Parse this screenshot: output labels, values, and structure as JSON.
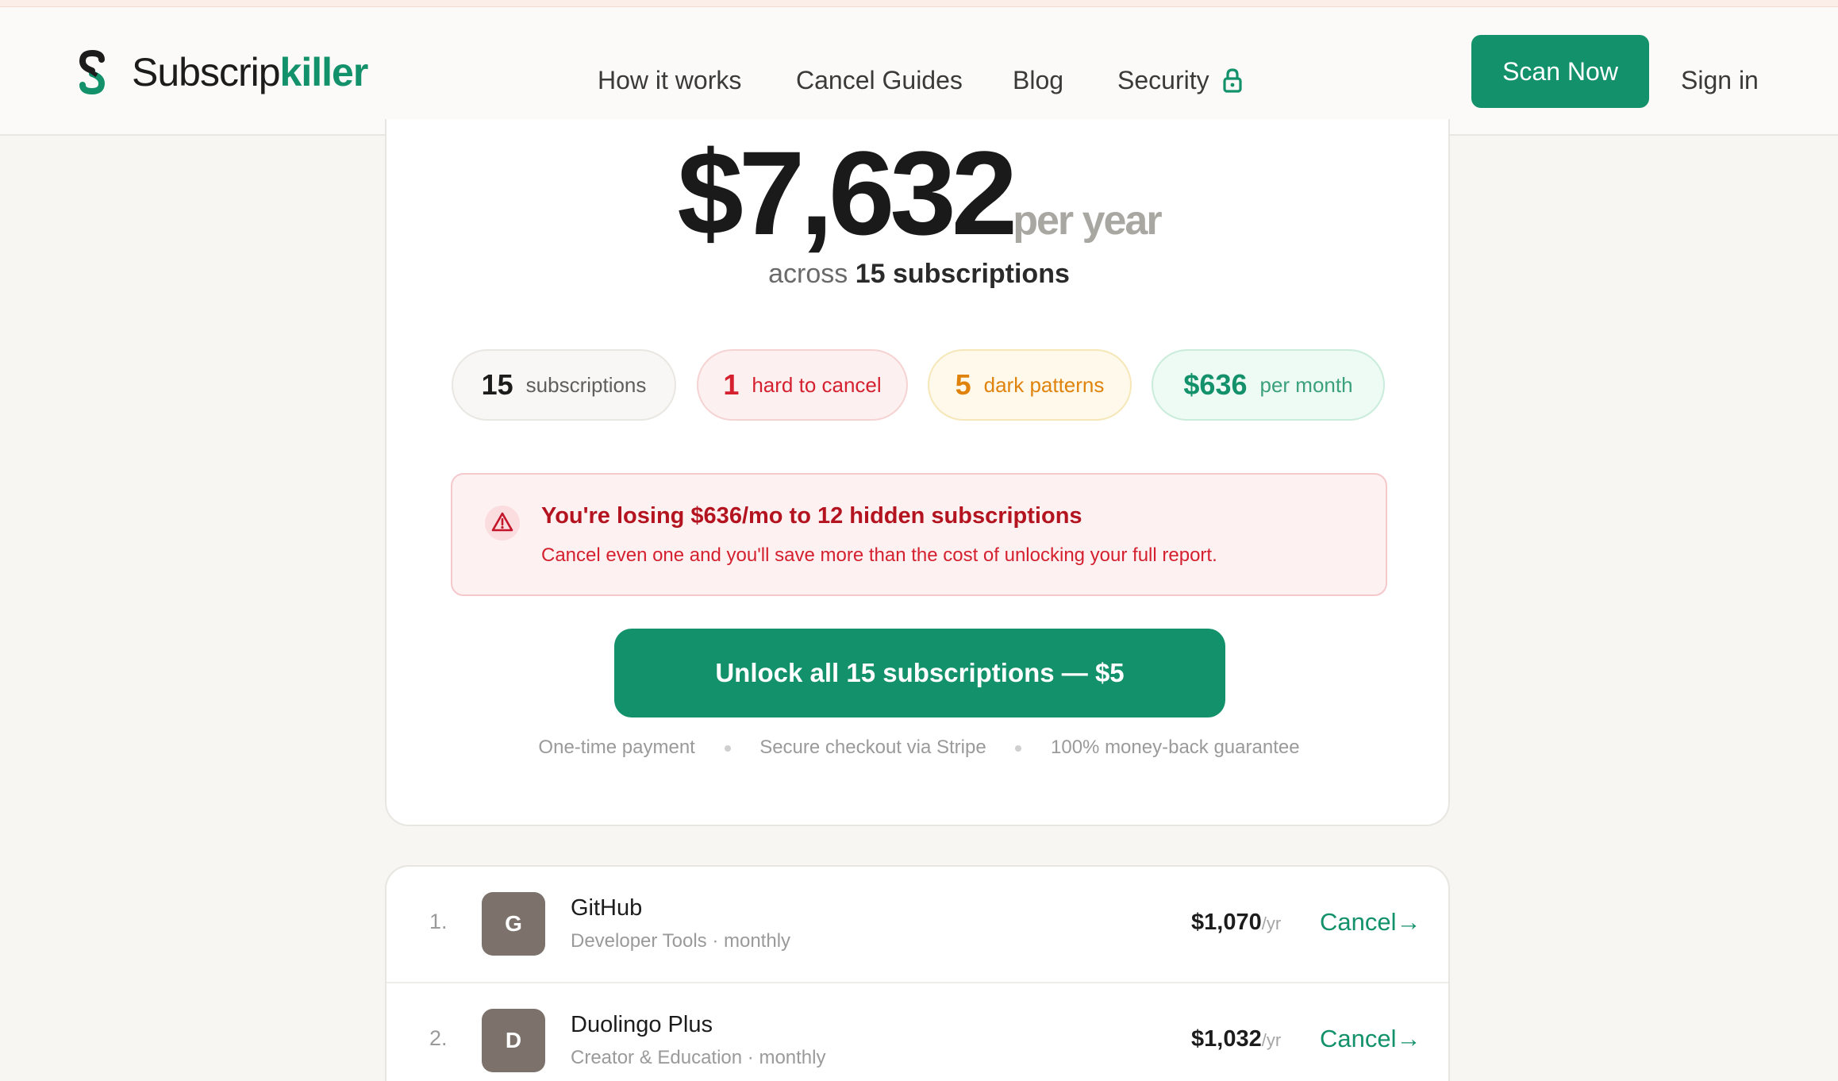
{
  "brand": {
    "name_part1": "Subscrip",
    "name_part2": "killer",
    "accent_color": "#12916a"
  },
  "nav": {
    "items": [
      "How it works",
      "Cancel Guides",
      "Blog",
      "Security"
    ],
    "security_icon": "lock-icon",
    "scan_button": "Scan Now",
    "sign_in": "Sign in"
  },
  "summary": {
    "amount": "$7,632",
    "period": "per year",
    "across_prefix": "across",
    "across_count": "15 subscriptions",
    "chips": [
      {
        "value": "15",
        "label": "subscriptions",
        "color": "#1c1c1c"
      },
      {
        "value": "1",
        "label": "hard to cancel",
        "color": "#d4202f"
      },
      {
        "value": "5",
        "label": "dark patterns",
        "color": "#e0830d"
      },
      {
        "value": "$636",
        "label": "per month",
        "color": "#12916a"
      }
    ],
    "alert": {
      "icon": "warning-triangle-icon",
      "title": "You're losing $636/mo to 12 hidden subscriptions",
      "body": "Cancel even one and you'll save more than the cost of unlocking your full report."
    },
    "unlock_button": "Unlock all 15 subscriptions — $5",
    "trust": [
      "One-time payment",
      "Secure checkout via Stripe",
      "100% money-back guarantee"
    ]
  },
  "subscriptions": [
    {
      "index": "1.",
      "initial": "G",
      "name": "GitHub",
      "meta": "Developer Tools · monthly",
      "price": "$1,070",
      "unit": "/yr",
      "action": "Cancel→"
    },
    {
      "index": "2.",
      "initial": "D",
      "name": "Duolingo Plus",
      "meta": "Creator & Education · monthly",
      "price": "$1,032",
      "unit": "/yr",
      "action": "Cancel→"
    }
  ]
}
